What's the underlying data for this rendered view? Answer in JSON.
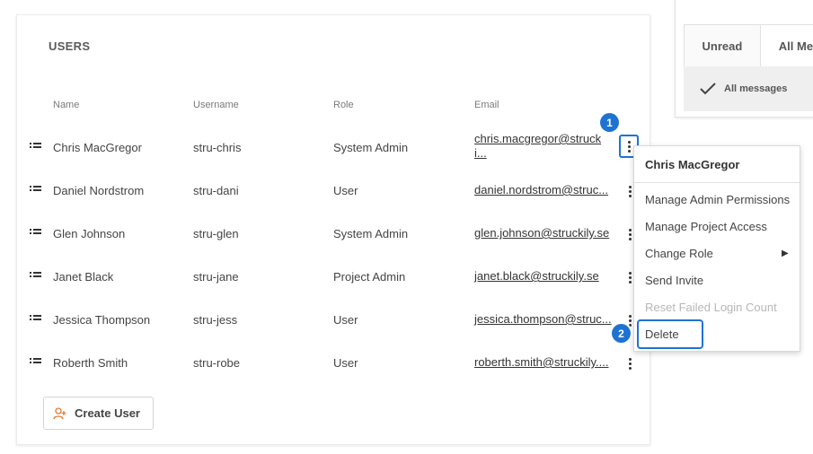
{
  "users_card": {
    "title": "USERS",
    "columns": {
      "name": "Name",
      "username": "Username",
      "role": "Role",
      "email": "Email"
    },
    "rows": [
      {
        "name": "Chris MacGregor",
        "username": "stru-chris",
        "role": "System Admin",
        "email_line1": "chris.macgregor@struck",
        "email_line2": "i..."
      },
      {
        "name": "Daniel Nordstrom",
        "username": "stru-dani",
        "role": "User",
        "email_line1": "daniel.nordstrom@struc..."
      },
      {
        "name": "Glen Johnson",
        "username": "stru-glen",
        "role": "System Admin",
        "email_line1": "glen.johnson@struckily.se"
      },
      {
        "name": "Janet Black",
        "username": "stru-jane",
        "role": "Project Admin",
        "email_line1": "janet.black@struckily.se"
      },
      {
        "name": "Jessica Thompson",
        "username": "stru-jess",
        "role": "User",
        "email_line1": "jessica.thompson@struc..."
      },
      {
        "name": "Roberth Smith",
        "username": "stru-robe",
        "role": "User",
        "email_line1": "roberth.smith@struckily...."
      }
    ],
    "create_button": {
      "label": "Create User",
      "icon": "add-user-icon"
    }
  },
  "messages_panel": {
    "tabs": [
      "Unread",
      "All Me"
    ],
    "filter_label": "All messages",
    "filter_icon": "checkmark-icon"
  },
  "context_menu": {
    "header": "Chris MacGregor",
    "items": [
      {
        "label": "Manage Admin Permissions",
        "disabled": false
      },
      {
        "label": "Manage Project Access",
        "disabled": false
      },
      {
        "label": "Change Role",
        "disabled": false,
        "has_submenu": true
      },
      {
        "label": "Send Invite",
        "disabled": false
      },
      {
        "label": "Reset Failed Login Count",
        "disabled": true
      },
      {
        "label": "Delete",
        "disabled": false
      }
    ],
    "submenu_arrow": "▶"
  },
  "callouts": {
    "one": "1",
    "two": "2"
  },
  "colors": {
    "accent": "#1e73d2",
    "create_icon": "#e07b2d"
  }
}
